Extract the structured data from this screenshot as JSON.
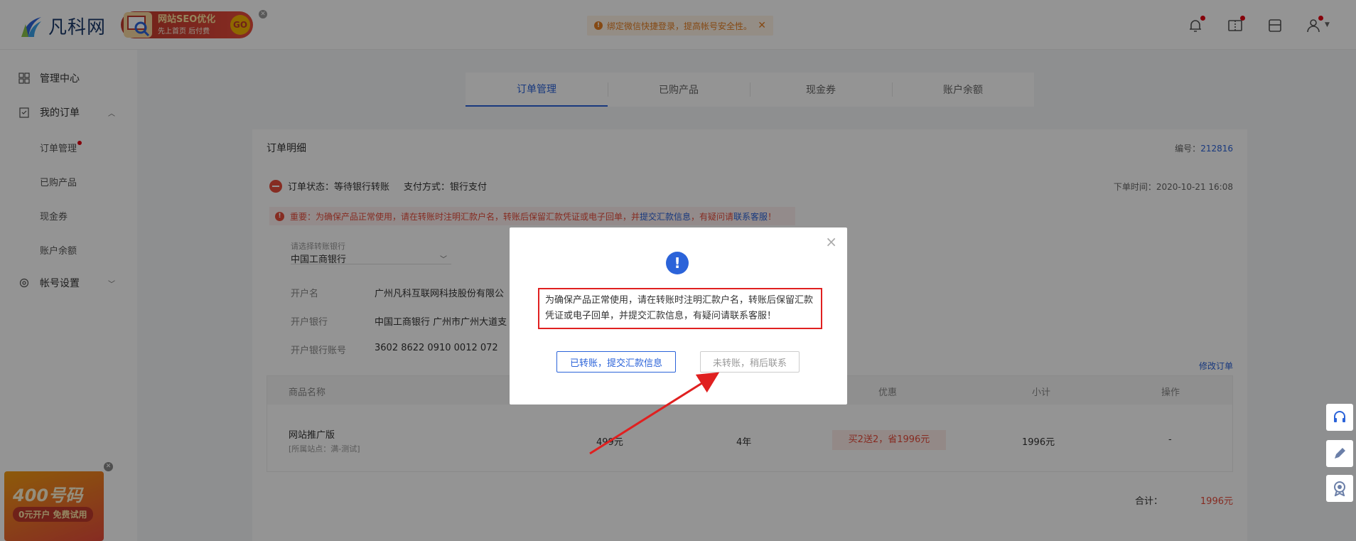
{
  "header": {
    "logo_text": "凡科网",
    "ad_title": "网站SEO优化",
    "ad_subtitle": "先上首页 后付费",
    "ad_go": "GO",
    "notice": "绑定微信快捷登录，提高帐号安全性。",
    "notice_close": "✕"
  },
  "sidebar": {
    "items": [
      {
        "label": "管理中心"
      },
      {
        "label": "我的订单"
      },
      {
        "label": "订单管理"
      },
      {
        "label": "已购产品"
      },
      {
        "label": "现金券"
      },
      {
        "label": "账户余额"
      },
      {
        "label": "帐号设置"
      }
    ],
    "ad_big": "400号码",
    "ad_small": "0元开户 免费试用"
  },
  "tabs": [
    {
      "label": "订单管理"
    },
    {
      "label": "已购产品"
    },
    {
      "label": "现金券"
    },
    {
      "label": "账户余额"
    }
  ],
  "order": {
    "title": "订单明细",
    "number_label": "编号：",
    "number": "212816",
    "status": "订单状态：等待银行转账",
    "pay_method": "支付方式：银行支付",
    "order_time": "下单时间：2020-10-21 16:08",
    "important_text": "重要：为确保产品正常使用，请在转账时注明汇款户名，转账后保留汇款凭证或电子回单，并",
    "important_link1": "提交汇款信息",
    "important_mid": "，有疑问请",
    "important_link2": "联系客服",
    "important_end": "！",
    "bank_select_label": "请选择转账银行",
    "bank_select_value": "中国工商银行",
    "account_name_label": "开户名",
    "account_name": "广州凡科互联网科技股份有限公",
    "bank_label": "开户银行",
    "bank": "中国工商银行 广州市广州大道支",
    "account_no_label": "开户银行账号",
    "account_no": "3602 8622 0910 0012 072",
    "edit_link": "修改订单",
    "table_headers": [
      "商品名称",
      "优惠",
      "小计",
      "操作"
    ],
    "row": {
      "product": "网站推广版",
      "site": "[所属站点：满-测试]",
      "price": "499元",
      "duration": "4年",
      "promo": "买2送2，省1996元",
      "subtotal": "1996元",
      "action": "-"
    },
    "total_label": "合计：",
    "total": "1996元"
  },
  "modal": {
    "message": "为确保产品正常使用，请在转账时注明汇款户名，转账后保留汇款凭证或电子回单，并提交汇款信息，有疑问请联系客服！",
    "primary_button": "已转账，提交汇款信息",
    "secondary_button": "未转账，稍后联系",
    "close": "×",
    "icon": "!"
  },
  "colors": {
    "accent": "#2b63d9",
    "danger": "#e74c3c",
    "highlight_border": "#e02020"
  }
}
